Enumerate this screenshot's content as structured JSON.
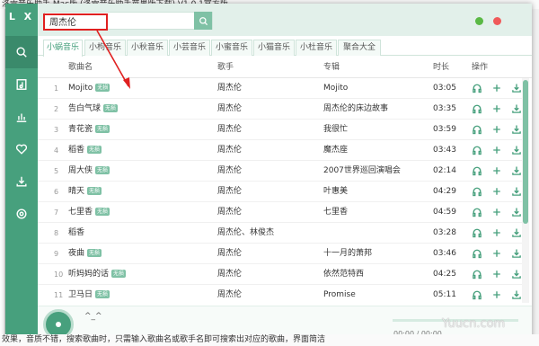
{
  "background": {
    "title": "洛雪音乐助手 Mac版 (洛雪音乐助手苹果版下载) V1.0.1官方版",
    "bottom": "效果，音质不错，搜索歌曲时，只需输入歌曲名或歌手名即可搜索出对应的歌曲，界面简洁"
  },
  "app": {
    "logo": "L X",
    "search": {
      "value": "周杰伦",
      "placeholder": ""
    }
  },
  "tabs": [
    "小蜗音乐",
    "小枸音乐",
    "小秋音乐",
    "小芸音乐",
    "小蜜音乐",
    "小猫音乐",
    "小杜音乐",
    "聚合大全"
  ],
  "table": {
    "headers": {
      "name": "歌曲名",
      "singer": "歌手",
      "album": "专辑",
      "duration": "时长",
      "actions": "操作"
    },
    "badge_label": "无损",
    "rows": [
      {
        "num": "1",
        "name": "Mojito",
        "badge": true,
        "singer": "周杰伦",
        "album": "Mojito",
        "duration": "03:05"
      },
      {
        "num": "2",
        "name": "告白气球",
        "badge": true,
        "singer": "周杰伦",
        "album": "周杰伦的床边故事",
        "duration": "03:35"
      },
      {
        "num": "3",
        "name": "青花瓷",
        "badge": true,
        "singer": "周杰伦",
        "album": "我很忙",
        "duration": "03:59"
      },
      {
        "num": "4",
        "name": "稻香",
        "badge": true,
        "singer": "周杰伦",
        "album": "魔杰座",
        "duration": "03:43"
      },
      {
        "num": "5",
        "name": "周大侠",
        "badge": true,
        "singer": "周杰伦",
        "album": "2007世界巡回演唱会",
        "duration": "02:14"
      },
      {
        "num": "6",
        "name": "晴天",
        "badge": true,
        "singer": "周杰伦",
        "album": "叶惠美",
        "duration": "04:29"
      },
      {
        "num": "7",
        "name": "七里香",
        "badge": true,
        "singer": "周杰伦",
        "album": "七里香",
        "duration": "04:59"
      },
      {
        "num": "8",
        "name": "稻香",
        "badge": false,
        "singer": "周杰伦、林俊杰",
        "album": "",
        "duration": "03:28"
      },
      {
        "num": "9",
        "name": "夜曲",
        "badge": true,
        "singer": "周杰伦",
        "album": "十一月的萧邦",
        "duration": "03:46"
      },
      {
        "num": "10",
        "name": "听妈妈的话",
        "badge": true,
        "singer": "周杰伦",
        "album": "依然范特西",
        "duration": "04:25"
      },
      {
        "num": "11",
        "name": "卫马日",
        "badge": true,
        "singer": "周杰伦",
        "album": "Promise",
        "duration": "05:11"
      }
    ]
  },
  "player": {
    "title": "^_^",
    "time": "00:00 / 00:00"
  },
  "watermark": "Yuucn.com",
  "colors": {
    "accent": "#47a07d",
    "highlight": "#e02020"
  }
}
